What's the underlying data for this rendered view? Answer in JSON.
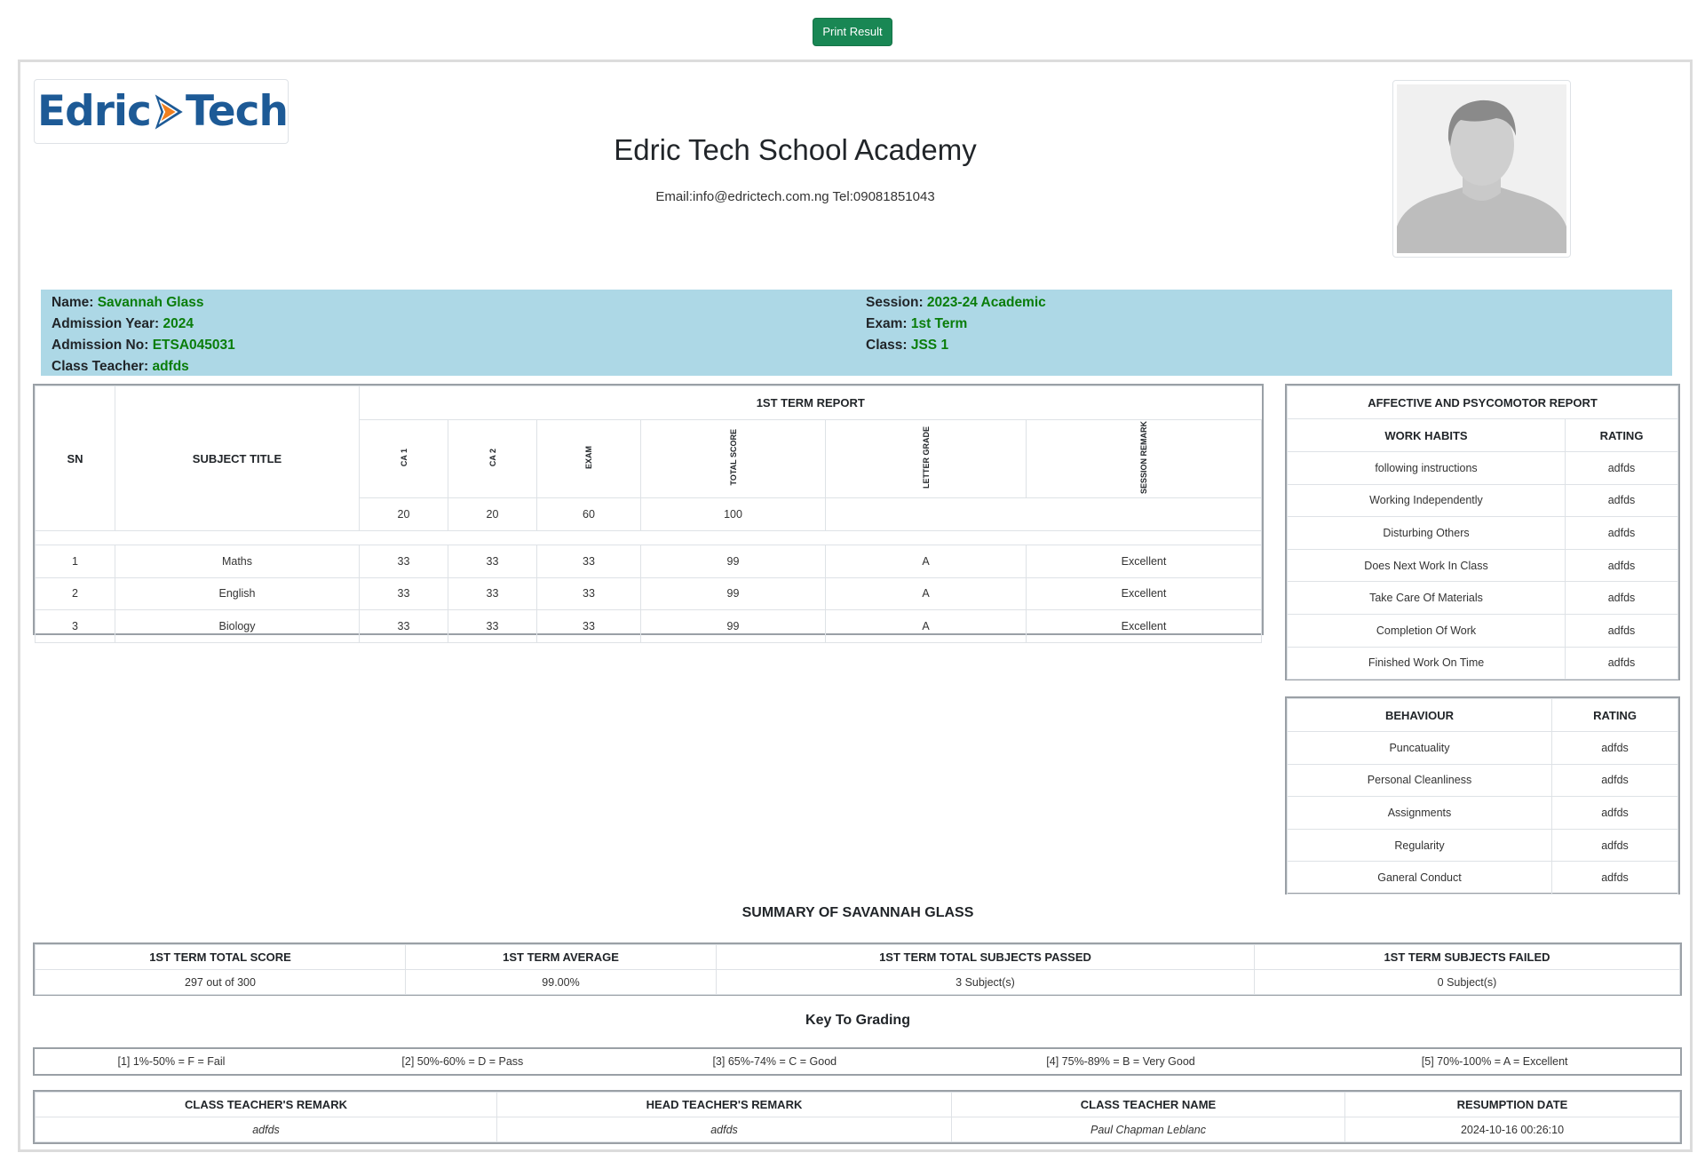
{
  "print_button": "Print Result",
  "logo": {
    "word1": "Edric",
    "word2": "Tech"
  },
  "school": {
    "name": "Edric Tech School Academy",
    "contact": "Email:info@edrictech.com.ng Tel:09081851043"
  },
  "student": {
    "name_label": "Name:",
    "name": "Savannah Glass",
    "year_label": "Admission Year:",
    "year": "2024",
    "adm_label": "Admission No:",
    "adm": "ETSA045031",
    "teacher_label": "Class Teacher:",
    "teacher": "adfds",
    "session_label": "Session:",
    "session": "2023-24 Academic",
    "exam_label": "Exam:",
    "exam": "1st Term",
    "class_label": "Class:",
    "class": "JSS 1"
  },
  "results": {
    "sn_header": "SN",
    "subject_header": "SUBJECT TITLE",
    "term_header": "1ST TERM REPORT",
    "columns": [
      "CA 1",
      "CA 2",
      "EXAM",
      "TOTAL SCORE",
      "LETTER GRADE",
      "SESSION REMARK"
    ],
    "max_scores": [
      "20",
      "20",
      "60",
      "100"
    ],
    "rows": [
      {
        "sn": "1",
        "subject": "Maths",
        "ca1": "33",
        "ca2": "33",
        "exam": "33",
        "total": "99",
        "grade": "A",
        "remark": "Excellent"
      },
      {
        "sn": "2",
        "subject": "English",
        "ca1": "33",
        "ca2": "33",
        "exam": "33",
        "total": "99",
        "grade": "A",
        "remark": "Excellent"
      },
      {
        "sn": "3",
        "subject": "Biology",
        "ca1": "33",
        "ca2": "33",
        "exam": "33",
        "total": "99",
        "grade": "A",
        "remark": "Excellent"
      }
    ]
  },
  "affective": {
    "title": "AFFECTIVE AND PSYCOMOTOR REPORT",
    "col1": "WORK HABITS",
    "col2": "RATING",
    "rows": [
      {
        "item": "following instructions",
        "rating": "adfds"
      },
      {
        "item": "Working Independently",
        "rating": "adfds"
      },
      {
        "item": "Disturbing Others",
        "rating": "adfds"
      },
      {
        "item": "Does Next Work In Class",
        "rating": "adfds"
      },
      {
        "item": "Take Care Of Materials",
        "rating": "adfds"
      },
      {
        "item": "Completion Of Work",
        "rating": "adfds"
      },
      {
        "item": "Finished Work On Time",
        "rating": "adfds"
      }
    ]
  },
  "behaviour": {
    "col1": "BEHAVIOUR",
    "col2": "RATING",
    "rows": [
      {
        "item": "Puncatuality",
        "rating": "adfds"
      },
      {
        "item": "Personal Cleanliness",
        "rating": "adfds"
      },
      {
        "item": "Assignments",
        "rating": "adfds"
      },
      {
        "item": "Regularity",
        "rating": "adfds"
      },
      {
        "item": "Ganeral Conduct",
        "rating": "adfds"
      }
    ]
  },
  "summary": {
    "title": "SUMMARY OF SAVANNAH GLASS",
    "headers": [
      "1ST TERM TOTAL SCORE",
      "1ST TERM AVERAGE",
      "1ST TERM TOTAL SUBJECTS PASSED",
      "1ST TERM SUBJECTS FAILED"
    ],
    "values": [
      "297 out of 300",
      "99.00%",
      "3 Subject(s)",
      "0 Subject(s)"
    ]
  },
  "grading": {
    "title": "Key To Grading",
    "keys": [
      "[1] 1%-50% = F = Fail",
      "[2] 50%-60% = D = Pass",
      "[3] 65%-74% = C = Good",
      "[4] 75%-89% = B = Very Good",
      "[5] 70%-100% = A = Excellent"
    ]
  },
  "remarks": {
    "headers": [
      "CLASS TEACHER'S REMARK",
      "HEAD TEACHER'S REMARK",
      "CLASS TEACHER NAME",
      "RESUMPTION DATE"
    ],
    "values": [
      "adfds",
      "adfds",
      "Paul Chapman Leblanc",
      "2024-10-16 00:26:10"
    ]
  },
  "colors": {
    "green": "#198754",
    "band": "#add8e6",
    "value_green": "#0a7d0a",
    "logo_blue": "#1d5a96",
    "logo_orange": "#f07f1e",
    "link": "#0d6efd"
  }
}
